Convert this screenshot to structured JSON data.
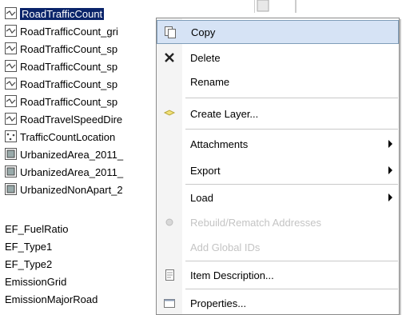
{
  "tree": {
    "items": [
      {
        "label": "RoadTrafficCount",
        "icon": "line-feature-class-icon",
        "selected": true
      },
      {
        "label": "RoadTrafficCount_gri",
        "icon": "line-feature-class-icon"
      },
      {
        "label": "RoadTrafficCount_sp",
        "icon": "line-feature-class-icon"
      },
      {
        "label": "RoadTrafficCount_sp",
        "icon": "line-feature-class-icon"
      },
      {
        "label": "RoadTrafficCount_sp",
        "icon": "line-feature-class-icon"
      },
      {
        "label": "RoadTrafficCount_sp",
        "icon": "line-feature-class-icon"
      },
      {
        "label": "RoadTravelSpeedDire",
        "icon": "line-feature-class-icon"
      },
      {
        "label": "TrafficCountLocation",
        "icon": "point-feature-class-icon"
      },
      {
        "label": "UrbanizedArea_2011_",
        "icon": "polygon-feature-class-icon"
      },
      {
        "label": "UrbanizedArea_2011_",
        "icon": "polygon-feature-class-icon"
      },
      {
        "label": "UrbanizedNonApart_2",
        "icon": "polygon-feature-class-icon"
      },
      {
        "label": "EF_FuelRatio"
      },
      {
        "label": "EF_Type1"
      },
      {
        "label": "EF_Type2"
      },
      {
        "label": "EmissionGrid"
      },
      {
        "label": "EmissionMajorRoad"
      }
    ]
  },
  "menu": {
    "items": [
      {
        "label": "Copy",
        "icon": "copy-icon",
        "hover": true
      },
      {
        "label": "Delete",
        "icon": "delete-icon"
      },
      {
        "label": "Rename"
      },
      {
        "label": "Create Layer...",
        "icon": "layer-icon"
      },
      {
        "label": "Attachments",
        "submenu": true
      },
      {
        "label": "Export",
        "submenu": true
      },
      {
        "label": "Load",
        "submenu": true
      },
      {
        "label": "Rebuild/Rematch Addresses",
        "icon": "rematch-icon",
        "disabled": true
      },
      {
        "label": "Add Global IDs",
        "disabled": true
      },
      {
        "label": "Item Description...",
        "icon": "item-description-icon"
      },
      {
        "label": "Properties...",
        "icon": "properties-icon"
      }
    ]
  },
  "colors": {
    "selection": "#0a246a",
    "menu_hover": "#d6e3f5",
    "disabled_text": "#c4c4c4"
  }
}
